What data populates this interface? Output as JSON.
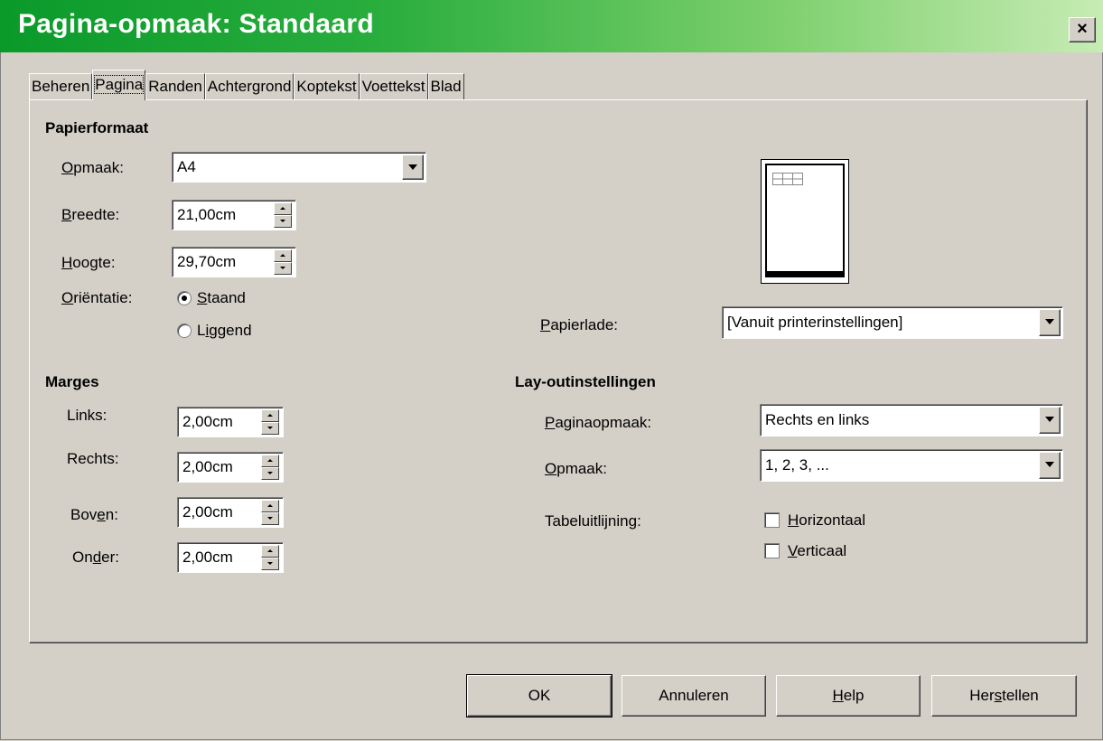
{
  "window": {
    "title": "Pagina-opmaak: Standaard",
    "close_label": "×"
  },
  "tabs": [
    {
      "label": "Beheren"
    },
    {
      "label": "Pagina"
    },
    {
      "label": "Randen"
    },
    {
      "label": "Achtergrond"
    },
    {
      "label": "Koptekst"
    },
    {
      "label": "Voettekst"
    },
    {
      "label": "Blad"
    }
  ],
  "paper_format": {
    "heading": "Papierformaat",
    "format_label": "Opmaak:",
    "format_value": "A4",
    "width_label": "Breedte:",
    "width_value": "21,00cm",
    "height_label": "Hoogte:",
    "height_value": "29,70cm",
    "orientation_label": "Oriëntatie:",
    "portrait_label": "Staand",
    "landscape_label": "Liggend",
    "selected_orientation": "Staand",
    "tray_label": "Papierlade:",
    "tray_value": "[Vanuit printerinstellingen]"
  },
  "margins": {
    "heading": "Marges",
    "left_label": "Links:",
    "left_value": "2,00cm",
    "right_label": "Rechts:",
    "right_value": "2,00cm",
    "top_label": "Boven:",
    "top_value": "2,00cm",
    "bottom_label": "Onder:",
    "bottom_value": "2,00cm"
  },
  "layout": {
    "heading": "Lay-outinstellingen",
    "page_layout_label": "Paginaopmaak:",
    "page_layout_value": "Rechts en links",
    "format_label": "Opmaak:",
    "format_value": "1, 2, 3, ...",
    "table_alignment_label": "Tabeluitlijning:",
    "horizontal_label": "Horizontaal",
    "vertical_label": "Verticaal"
  },
  "buttons": {
    "ok": "OK",
    "cancel": "Annuleren",
    "help": "Help",
    "reset": "Herstellen"
  }
}
